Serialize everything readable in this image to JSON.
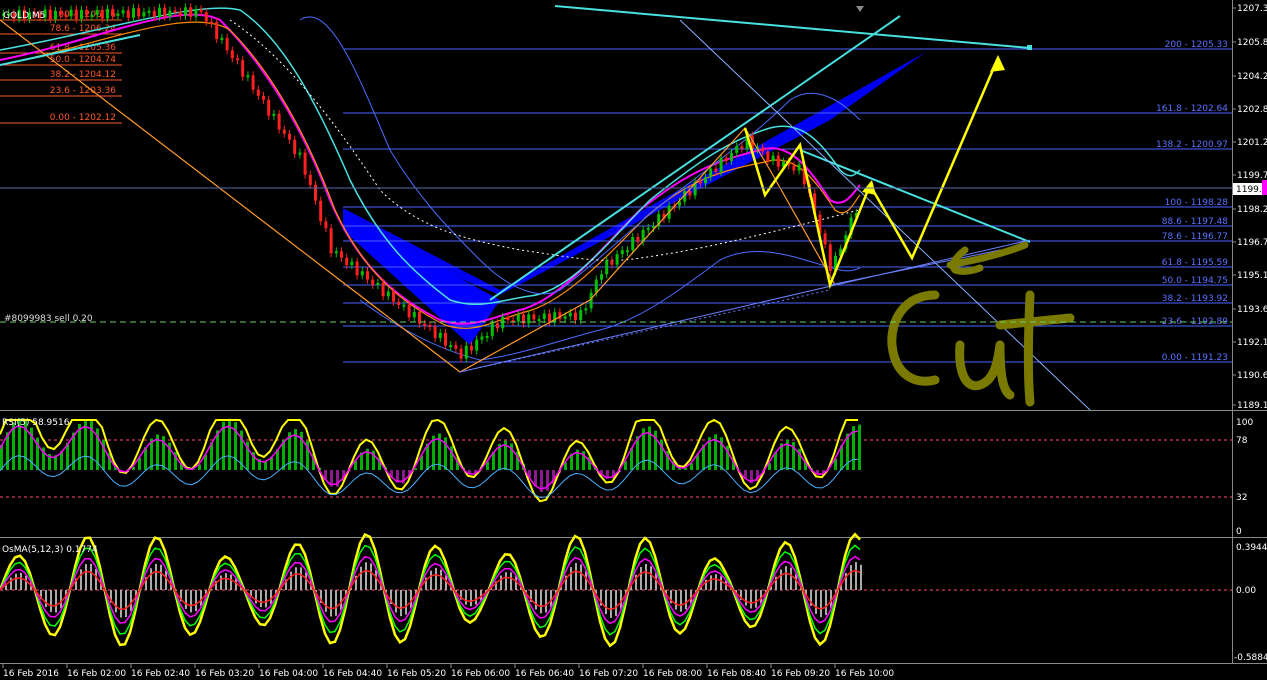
{
  "symbol": "GOLD,M5",
  "order_label": "#8099983 sell 0.20",
  "annotation_text": "CuT",
  "colors": {
    "background": "#000000",
    "bull": "#00c000",
    "bear": "#ff2020",
    "fib": "#4a63ff",
    "fib_label": "#5b72ff",
    "left_fib": "#ff5a2a",
    "cyan": "#49e0e0",
    "yellow": "#ffff00",
    "blue_fill": "#0000ff",
    "magenta": "#ff00ff",
    "annotation": "#7a7a00",
    "axis_text": "#ffffff"
  },
  "price_axis": {
    "labels": [
      "1207.39",
      "1205.81",
      "1204.23",
      "1202.81",
      "1201.29",
      "1199.74",
      "1198.21",
      "1196.74",
      "1195.19",
      "1193.69",
      "1192.19",
      "1190.69",
      "1189.19"
    ],
    "current_price": "1199.14"
  },
  "fib_levels": [
    {
      "label": "200 - 1205.33"
    },
    {
      "label": "161.8 - 1202.64"
    },
    {
      "label": "138.2 - 1200.97"
    },
    {
      "label": "100 - 1198.28"
    },
    {
      "label": "88.6 - 1197.48"
    },
    {
      "label": "78.6 - 1196.77"
    },
    {
      "label": "61.8 - 1195.59"
    },
    {
      "label": "50.0 - 1194.75"
    },
    {
      "label": "38.2 - 1193.92"
    },
    {
      "label": "23.6 - 1192.89"
    },
    {
      "label": "0.00 - 1191.23"
    }
  ],
  "left_fib_levels": [
    {
      "label": "100 - 1206.76"
    },
    {
      "label": "78.6 - 1206.24"
    },
    {
      "label": "61.8 - 1205.36"
    },
    {
      "label": "50.0 - 1204.74"
    },
    {
      "label": "38.2 - 1204.12"
    },
    {
      "label": "23.6 - 1203.36"
    },
    {
      "label": "0.00 - 1202.12"
    }
  ],
  "rsi": {
    "title": "RSI(5) 58.9516",
    "axis": [
      "100",
      "78",
      "32",
      "0"
    ]
  },
  "osma": {
    "title": "OsMA(5,12,3) 0.1774",
    "axis": [
      "0.3944",
      "0.00",
      "-0.5884"
    ]
  },
  "time_axis": [
    "16 Feb 2016",
    "16 Feb 02:00",
    "16 Feb 02:40",
    "16 Feb 03:20",
    "16 Feb 04:00",
    "16 Feb 04:40",
    "16 Feb 05:20",
    "16 Feb 06:00",
    "16 Feb 06:40",
    "16 Feb 07:20",
    "16 Feb 08:00",
    "16 Feb 08:40",
    "16 Feb 09:20",
    "16 Feb 10:00"
  ]
}
